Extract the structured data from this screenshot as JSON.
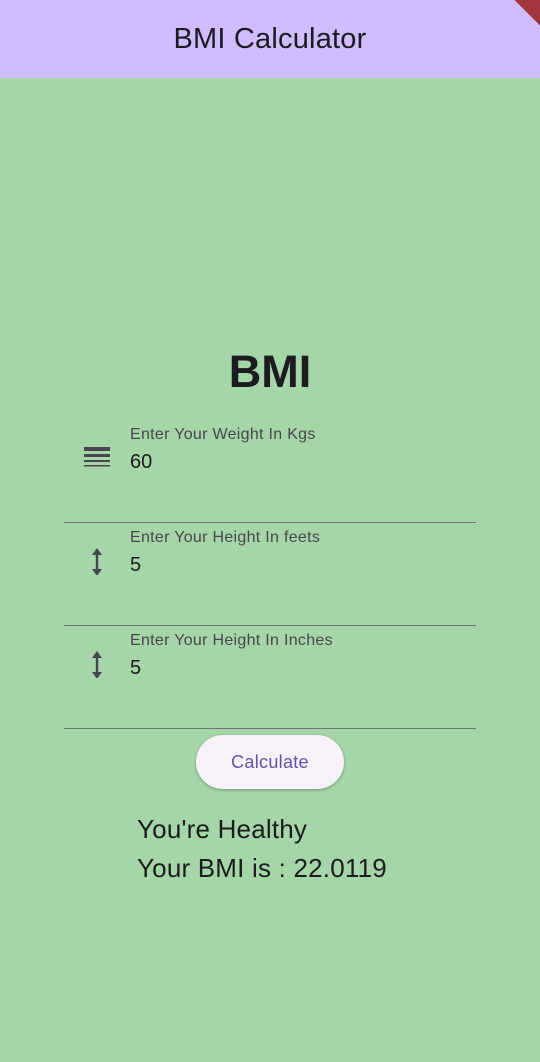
{
  "app_bar": {
    "title": "BMI Calculator",
    "background": "#d0bcff"
  },
  "main": {
    "background": "#a5d6a7",
    "headline": "BMI",
    "fields": [
      {
        "icon": "line-weight-icon",
        "label": "Enter Your Weight In Kgs",
        "value": "60"
      },
      {
        "icon": "height-icon",
        "label": "Enter Your Height In feets",
        "value": "5"
      },
      {
        "icon": "height-icon",
        "label": "Enter Your Height In Inches",
        "value": "5"
      }
    ],
    "calculate_label": "Calculate",
    "result": {
      "status": "You're Healthy",
      "bmi": "Your BMI is : 22.0119"
    }
  },
  "colors": {
    "accent": "#6750a4",
    "debug_banner": "#a4343f"
  }
}
